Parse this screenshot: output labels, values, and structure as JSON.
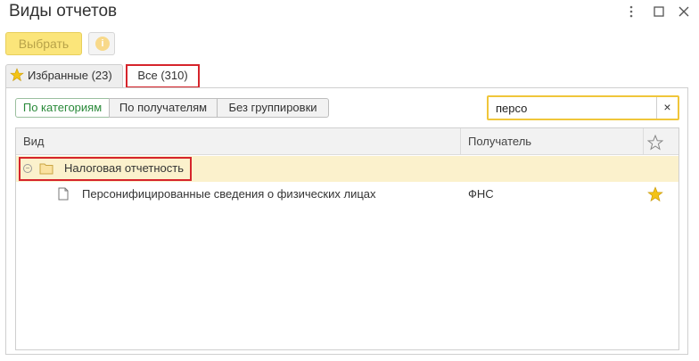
{
  "window": {
    "title": "Виды отчетов",
    "menu_icon": "more-vert-icon",
    "maximize_icon": "maximize-icon",
    "close_icon": "close-icon"
  },
  "toolbar": {
    "select_label": "Выбрать",
    "info_icon": "info-icon"
  },
  "tabs": [
    {
      "label": "Избранные (23)",
      "icon": "star-icon",
      "active": false
    },
    {
      "label": "Все (310)",
      "active": true
    }
  ],
  "grouping": {
    "options": [
      "По категориям",
      "По получателям",
      "Без группировки"
    ],
    "selected": "По категориям"
  },
  "search": {
    "value": "персо",
    "clear_glyph": "×"
  },
  "table": {
    "columns": [
      "Вид",
      "Получатель"
    ],
    "favorite_column_icon": "star-outline-icon",
    "groups": [
      {
        "label": "Налоговая отчетность",
        "expanded": true,
        "items": [
          {
            "name": "Персонифицированные сведения о физических лицах",
            "recipient": "ФНС",
            "favorite": true
          }
        ]
      }
    ]
  },
  "colors": {
    "accent_yellow": "#fbe57a",
    "highlight_row": "#fbf1cc",
    "annotation_red": "#d6242b",
    "active_green": "#2a8a3a",
    "search_border": "#f0c63a"
  }
}
